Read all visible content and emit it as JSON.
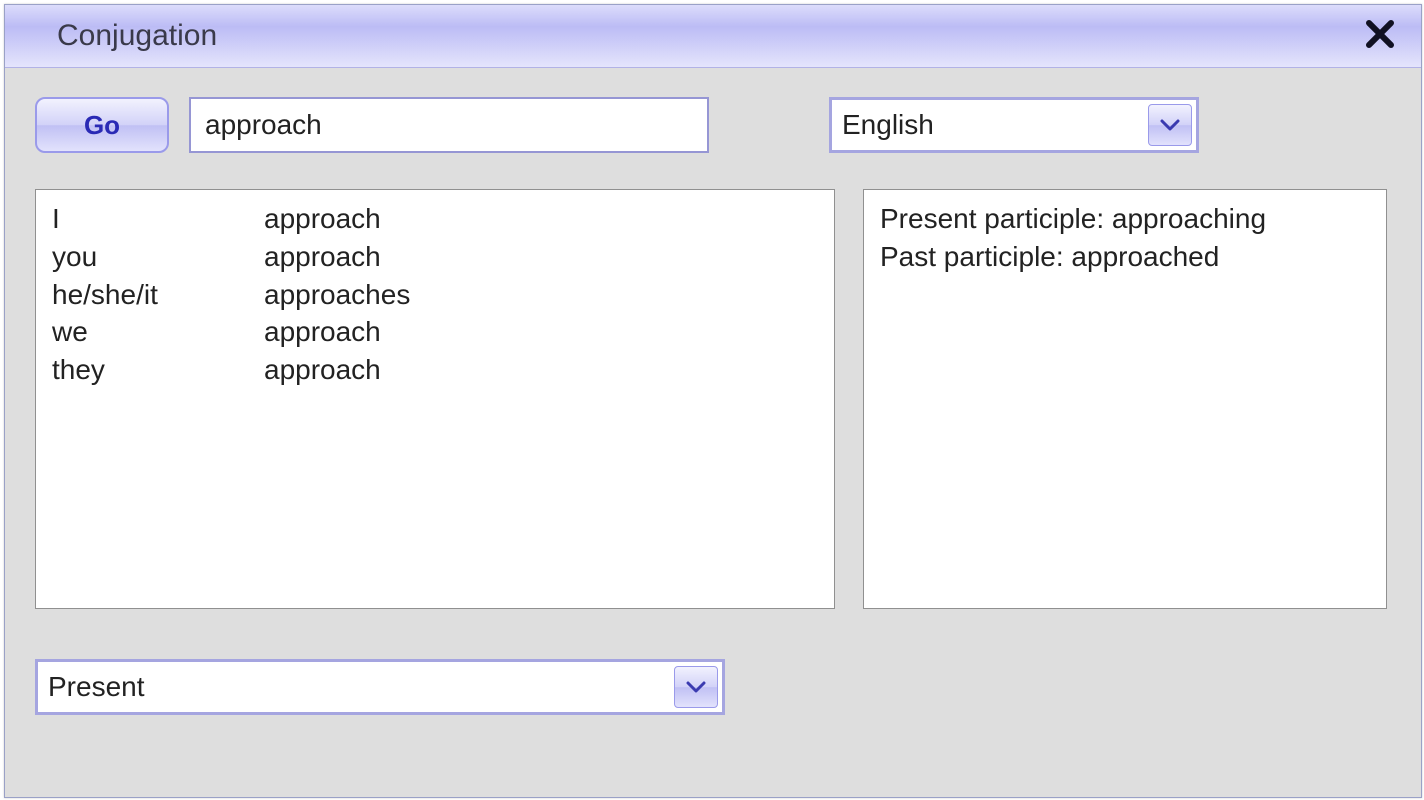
{
  "window": {
    "title": "Conjugation"
  },
  "controls": {
    "go_label": "Go",
    "verb_value": "approach",
    "language_selected": "English",
    "tense_selected": "Present"
  },
  "conjugation": {
    "rows": [
      {
        "pronoun": "I",
        "form": "approach"
      },
      {
        "pronoun": "you",
        "form": "approach"
      },
      {
        "pronoun": "he/she/it",
        "form": "approaches"
      },
      {
        "pronoun": "we",
        "form": "approach"
      },
      {
        "pronoun": "they",
        "form": "approach"
      }
    ]
  },
  "participles": {
    "present_label": "Present participle:",
    "present_value": "approaching",
    "past_label": "Past participle:",
    "past_value": "approached"
  }
}
